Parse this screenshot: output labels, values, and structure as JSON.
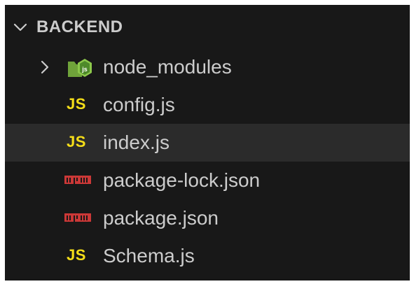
{
  "explorer": {
    "section_title": "BACKEND",
    "items": [
      {
        "label": "node_modules",
        "kind": "folder",
        "icon": "node-modules-folder-icon"
      },
      {
        "label": "config.js",
        "kind": "file",
        "icon": "JS"
      },
      {
        "label": "index.js",
        "kind": "file",
        "icon": "JS",
        "selected": true
      },
      {
        "label": "package-lock.json",
        "kind": "file",
        "icon": "npm-icon"
      },
      {
        "label": "package.json",
        "kind": "file",
        "icon": "npm-icon"
      },
      {
        "label": "Schema.js",
        "kind": "file",
        "icon": "JS"
      }
    ]
  },
  "colors": {
    "background": "#181818",
    "selected_row": "#2b2b2b",
    "text": "#cccccc",
    "js_yellow": "#f5de19",
    "npm_red": "#cb3837",
    "node_green": "#8cc84b"
  }
}
